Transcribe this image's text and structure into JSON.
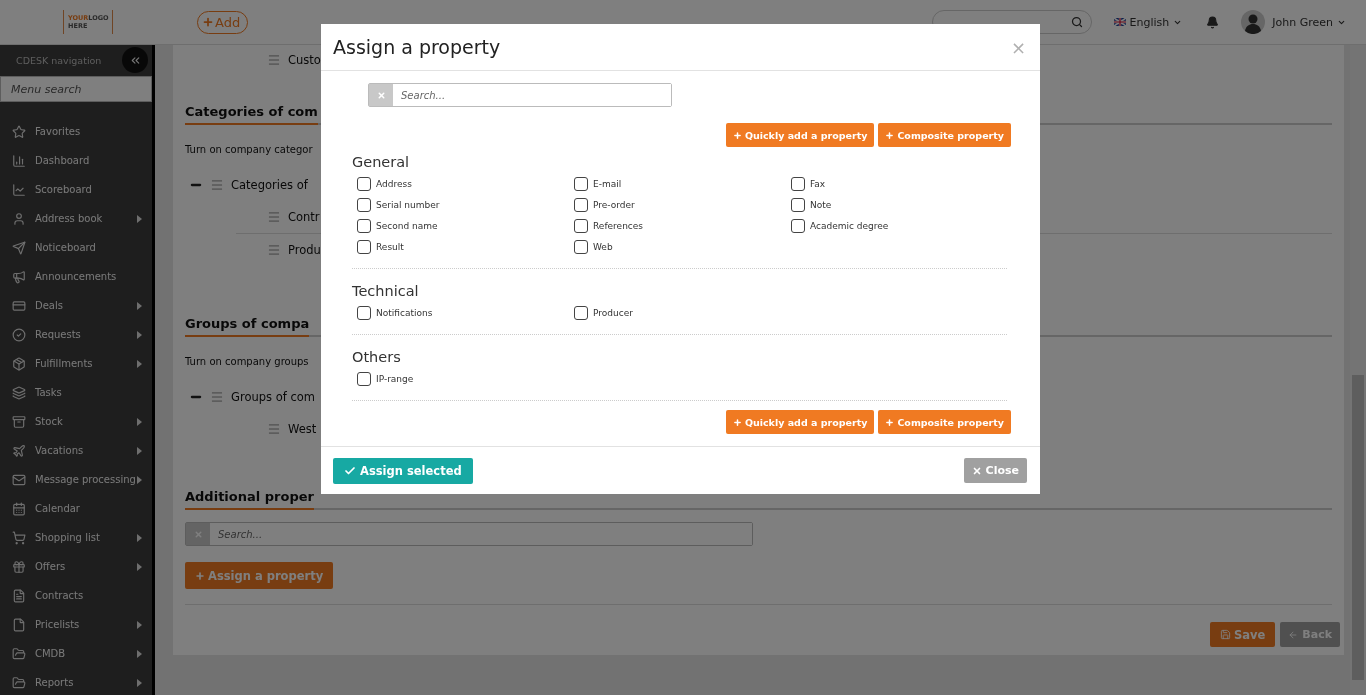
{
  "header": {
    "logo": [
      "YOUR",
      "LOGO",
      "HERE"
    ],
    "add_button": "Add",
    "language": "English",
    "user": "John Green"
  },
  "sidebar": {
    "title": "CDESK navigation",
    "search": {
      "placeholder": "Menu search"
    },
    "items": [
      {
        "label": "Favorites",
        "submenu": false
      },
      {
        "label": "Dashboard",
        "submenu": false
      },
      {
        "label": "Scoreboard",
        "submenu": false
      },
      {
        "label": "Address book",
        "submenu": true
      },
      {
        "label": "Noticeboard",
        "submenu": false
      },
      {
        "label": "Announcements",
        "submenu": false
      },
      {
        "label": "Deals",
        "submenu": true
      },
      {
        "label": "Requests",
        "submenu": true
      },
      {
        "label": "Fulfillments",
        "submenu": true
      },
      {
        "label": "Tasks",
        "submenu": false
      },
      {
        "label": "Stock",
        "submenu": true
      },
      {
        "label": "Vacations",
        "submenu": true
      },
      {
        "label": "Message processing",
        "submenu": true
      },
      {
        "label": "Calendar",
        "submenu": false
      },
      {
        "label": "Shopping list",
        "submenu": true
      },
      {
        "label": "Offers",
        "submenu": true
      },
      {
        "label": "Contracts",
        "submenu": false
      },
      {
        "label": "Pricelists",
        "submenu": true
      },
      {
        "label": "CMDB",
        "submenu": true
      },
      {
        "label": "Reports",
        "submenu": true
      }
    ]
  },
  "content": {
    "top_item": "Custo",
    "sections": [
      {
        "heading": "Categories of com",
        "description": "Turn on company categor",
        "tree": {
          "label": "Categories of",
          "expanded": true,
          "children": [
            "Contr",
            "Produ"
          ]
        }
      },
      {
        "heading": "Groups of compa",
        "description": "Turn on company groups",
        "tree": {
          "label": "Groups of com",
          "expanded": true,
          "children": [
            "West"
          ]
        }
      }
    ],
    "additional": {
      "heading": "Additional proper",
      "search": {
        "placeholder": "Search..."
      },
      "assign_button": "Assign a property"
    },
    "save_button": "Save",
    "back_button": {
      "label": "Back",
      "disabled": true
    }
  },
  "modal": {
    "title": "Assign a property",
    "close_icon": "×",
    "search": {
      "placeholder": "Search..."
    },
    "top_buttons": [
      "Quickly add a property",
      "Composite property"
    ],
    "groups": [
      {
        "title": "General",
        "properties": [
          {
            "label": "Address",
            "checked": false
          },
          {
            "label": "E-mail",
            "checked": false
          },
          {
            "label": "Fax",
            "checked": false
          },
          {
            "label": "Serial number",
            "checked": false
          },
          {
            "label": "Pre-order",
            "checked": false
          },
          {
            "label": "Note",
            "checked": false
          },
          {
            "label": "Second name",
            "checked": false
          },
          {
            "label": "References",
            "checked": false
          },
          {
            "label": "Academic degree",
            "checked": false
          },
          {
            "label": "Result",
            "checked": false
          },
          {
            "label": "Web",
            "checked": false
          }
        ]
      },
      {
        "title": "Technical",
        "properties": [
          {
            "label": "Notifications",
            "checked": false
          },
          {
            "label": "Producer",
            "checked": false
          }
        ]
      },
      {
        "title": "Others",
        "properties": [
          {
            "label": "IP-range",
            "checked": false
          }
        ]
      }
    ],
    "bottom_buttons": [
      "Quickly add a property",
      "Composite property"
    ],
    "assign_button": "Assign selected",
    "close_button": {
      "label": "Close",
      "disabled": true
    }
  }
}
